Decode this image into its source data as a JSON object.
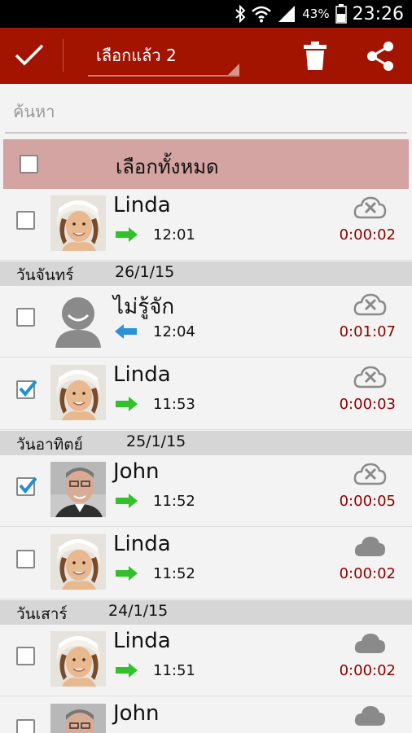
{
  "status_bar": {
    "battery": "43%",
    "time": "23:26",
    "icons": [
      "bluetooth-icon",
      "wifi-icon",
      "signal-icon",
      "battery-icon"
    ]
  },
  "action_bar": {
    "selected_label": "เลือกแล้ว 2",
    "icons": [
      "check-icon",
      "trash-icon",
      "share-icon"
    ],
    "color": "#a21300"
  },
  "search": {
    "placeholder": "ค้นหา",
    "value": ""
  },
  "select_all": {
    "label": "เลือกทั้งหมด",
    "checked": false
  },
  "date_headers": [
    {
      "day": "วันจันทร์",
      "date": "26/1/15"
    },
    {
      "day": "วันอาทิตย์",
      "date": "25/1/15"
    },
    {
      "day": "วันเสาร์",
      "date": "24/1/15"
    }
  ],
  "calls": [
    {
      "name": "Linda",
      "direction": "outgoing",
      "time": "12:01",
      "duration": "0:00:02",
      "checked": false,
      "cloud": "not-synced",
      "avatar": "woman"
    },
    {
      "name": "ไม่รู้จัก",
      "direction": "incoming",
      "time": "12:04",
      "duration": "0:01:07",
      "checked": false,
      "cloud": "not-synced",
      "avatar": "unknown"
    },
    {
      "name": "Linda",
      "direction": "outgoing",
      "time": "11:53",
      "duration": "0:00:03",
      "checked": true,
      "cloud": "not-synced",
      "avatar": "woman"
    },
    {
      "name": "John",
      "direction": "outgoing",
      "time": "11:52",
      "duration": "0:00:05",
      "checked": true,
      "cloud": "not-synced",
      "avatar": "man"
    },
    {
      "name": "Linda",
      "direction": "outgoing",
      "time": "11:52",
      "duration": "0:00:02",
      "checked": false,
      "cloud": "synced",
      "avatar": "woman"
    },
    {
      "name": "Linda",
      "direction": "outgoing",
      "time": "11:51",
      "duration": "0:00:02",
      "checked": false,
      "cloud": "synced",
      "avatar": "woman"
    },
    {
      "name": "John",
      "direction": "outgoing",
      "time": "",
      "duration": "",
      "checked": false,
      "cloud": "synced",
      "avatar": "man"
    }
  ]
}
